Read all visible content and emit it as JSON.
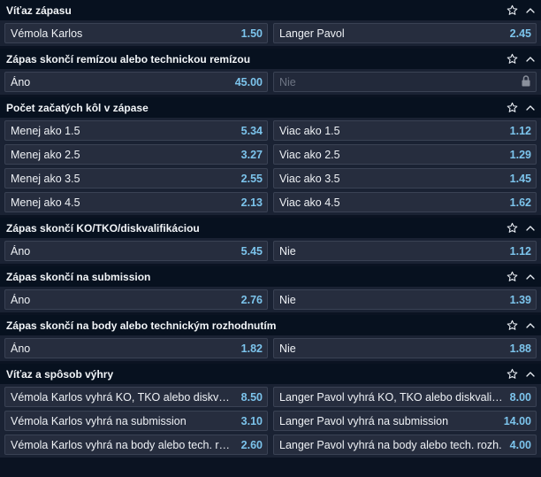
{
  "sections": [
    {
      "title": "Víťaz zápasu",
      "rows": [
        [
          {
            "label": "Vémola Karlos",
            "odd": "1.50"
          },
          {
            "label": "Langer Pavol",
            "odd": "2.45"
          }
        ]
      ]
    },
    {
      "title": "Zápas skončí remízou alebo technickou remízou",
      "rows": [
        [
          {
            "label": "Áno",
            "odd": "45.00"
          },
          {
            "label": "Nie",
            "odd": "",
            "locked": true
          }
        ]
      ]
    },
    {
      "title": "Počet začatých kôl v zápase",
      "rows": [
        [
          {
            "label": "Menej ako 1.5",
            "odd": "5.34"
          },
          {
            "label": "Viac ako 1.5",
            "odd": "1.12"
          }
        ],
        [
          {
            "label": "Menej ako 2.5",
            "odd": "3.27"
          },
          {
            "label": "Viac ako 2.5",
            "odd": "1.29"
          }
        ],
        [
          {
            "label": "Menej ako 3.5",
            "odd": "2.55"
          },
          {
            "label": "Viac ako 3.5",
            "odd": "1.45"
          }
        ],
        [
          {
            "label": "Menej ako 4.5",
            "odd": "2.13"
          },
          {
            "label": "Viac ako 4.5",
            "odd": "1.62"
          }
        ]
      ]
    },
    {
      "title": "Zápas skončí KO/TKO/diskvalifikáciou",
      "rows": [
        [
          {
            "label": "Áno",
            "odd": "5.45"
          },
          {
            "label": "Nie",
            "odd": "1.12"
          }
        ]
      ]
    },
    {
      "title": "Zápas skončí na submission",
      "rows": [
        [
          {
            "label": "Áno",
            "odd": "2.76"
          },
          {
            "label": "Nie",
            "odd": "1.39"
          }
        ]
      ]
    },
    {
      "title": "Zápas skončí na body alebo technickým rozhodnutím",
      "rows": [
        [
          {
            "label": "Áno",
            "odd": "1.82"
          },
          {
            "label": "Nie",
            "odd": "1.88"
          }
        ]
      ]
    },
    {
      "title": "Víťaz a spôsob výhry",
      "rows": [
        [
          {
            "label": "Vémola Karlos vyhrá KO, TKO alebo diskvalifikáciou",
            "odd": "8.50"
          },
          {
            "label": "Langer Pavol vyhrá KO, TKO alebo diskvalifikáciou",
            "odd": "8.00"
          }
        ],
        [
          {
            "label": "Vémola Karlos vyhrá na submission",
            "odd": "3.10"
          },
          {
            "label": "Langer Pavol vyhrá na submission",
            "odd": "14.00"
          }
        ],
        [
          {
            "label": "Vémola Karlos vyhrá na body alebo tech. rozh.",
            "odd": "2.60"
          },
          {
            "label": "Langer Pavol vyhrá na body alebo tech. rozh.",
            "odd": "4.00"
          }
        ]
      ]
    }
  ],
  "icons": {
    "favorite": "star-outline-icon",
    "collapse": "chevron-up-icon",
    "locked": "lock-icon"
  },
  "colors": {
    "odds": "#7cc4ec",
    "header_bg": "#07111f",
    "cell_bg": "#262d3e"
  }
}
